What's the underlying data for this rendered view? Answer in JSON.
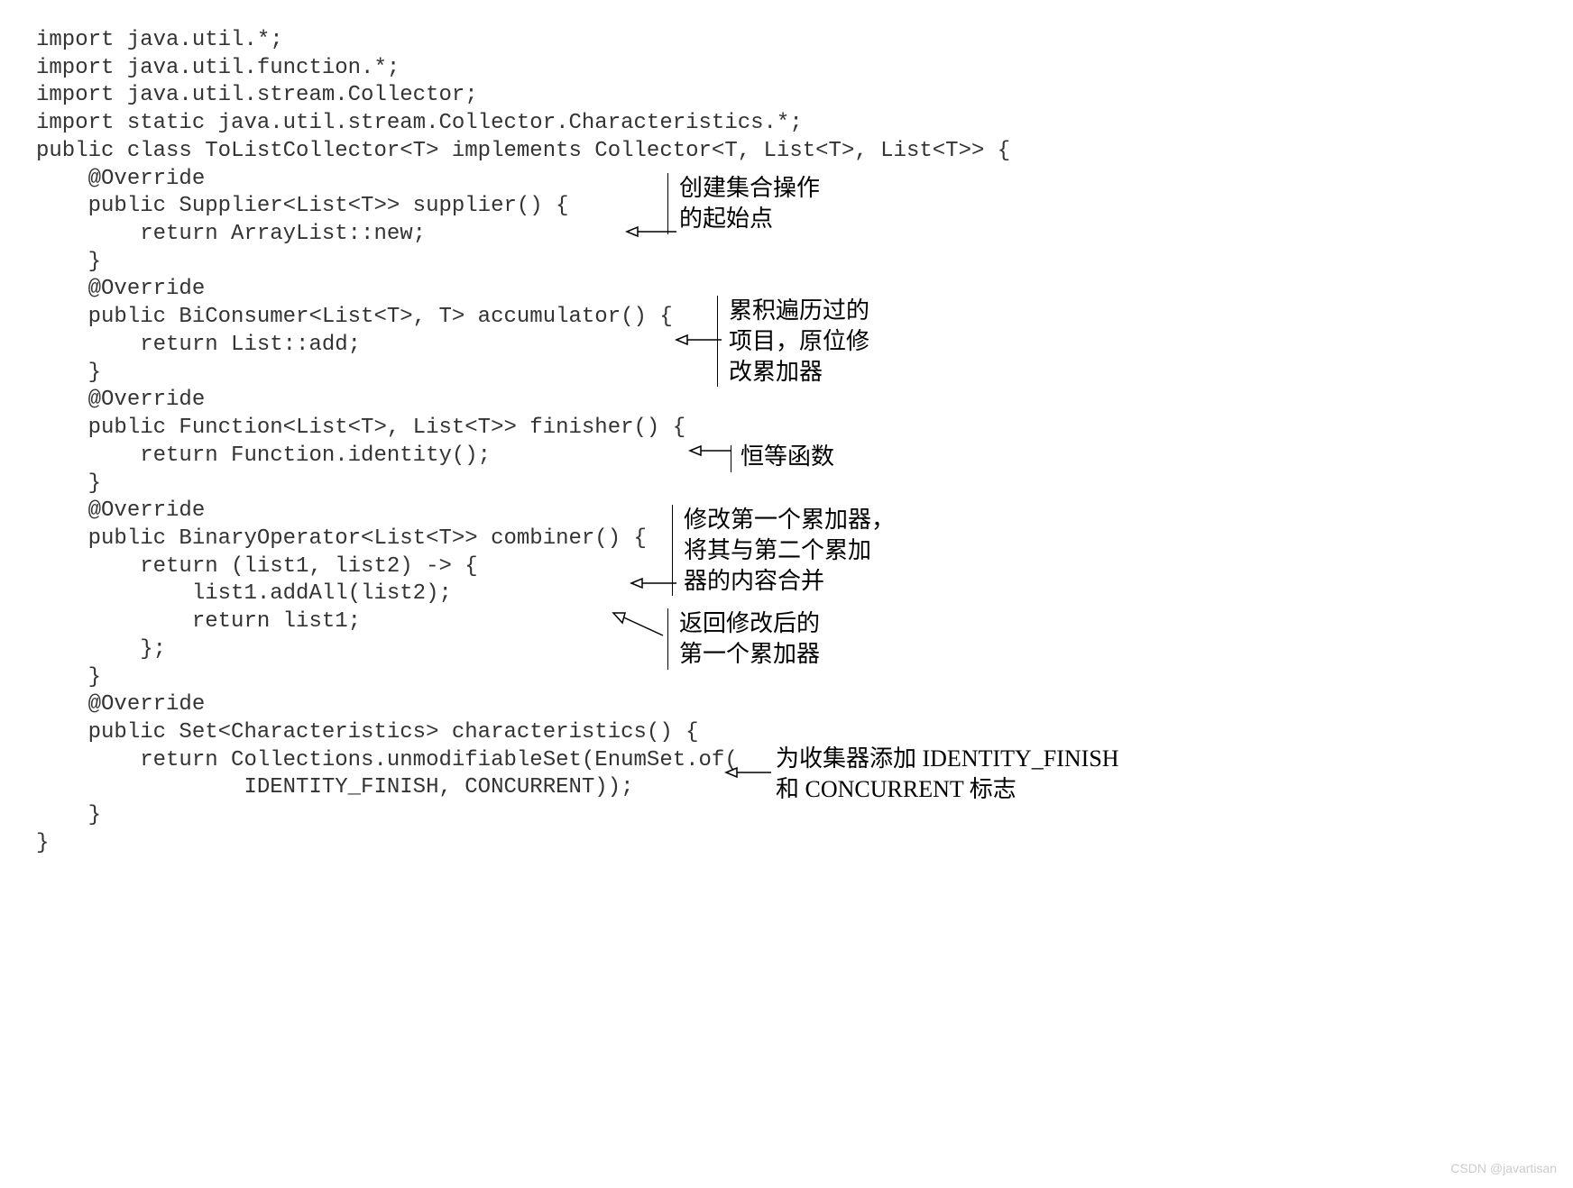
{
  "code": {
    "l01": "import java.util.*;",
    "l02": "import java.util.function.*;",
    "l03": "import java.util.stream.Collector;",
    "l04": "import static java.util.stream.Collector.Characteristics.*;",
    "l05": "public class ToListCollector<T> implements Collector<T, List<T>, List<T>> {",
    "l06": "    @Override",
    "l07": "    public Supplier<List<T>> supplier() {",
    "l08": "        return ArrayList::new;",
    "l09": "    }",
    "l10": "    @Override",
    "l11": "    public BiConsumer<List<T>, T> accumulator() {",
    "l12": "        return List::add;",
    "l13": "    }",
    "l14": "    @Override",
    "l15": "    public Function<List<T>, List<T>> finisher() {",
    "l16": "        return Function.identity();",
    "l17": "    }",
    "l18": "    @Override",
    "l19": "    public BinaryOperator<List<T>> combiner() {",
    "l20": "        return (list1, list2) -> {",
    "l21": "            list1.addAll(list2);",
    "l22": "            return list1;",
    "l23": "        };",
    "l24": "    }",
    "l25": "    @Override",
    "l26": "    public Set<Characteristics> characteristics() {",
    "l27": "        return Collections.unmodifiableSet(EnumSet.of(",
    "l28": "                IDENTITY_FINISH, CONCURRENT));",
    "l29": "    }",
    "l30": "}"
  },
  "annotations": {
    "a1_line1": "创建集合操作",
    "a1_line2": "的起始点",
    "a2_line1": "累积遍历过的",
    "a2_line2": "项目，原位修",
    "a2_line3": "改累加器",
    "a3": "恒等函数",
    "a4_line1": "修改第一个累加器，",
    "a4_line2": "将其与第二个累加",
    "a4_line3": "器的内容合并",
    "a5_line1": "返回修改后的",
    "a5_line2": "第一个累加器",
    "a6_line1": "为收集器添加 IDENTITY_FINISH",
    "a6_line2": "和 CONCURRENT 标志"
  },
  "watermark": "CSDN @javartisan"
}
